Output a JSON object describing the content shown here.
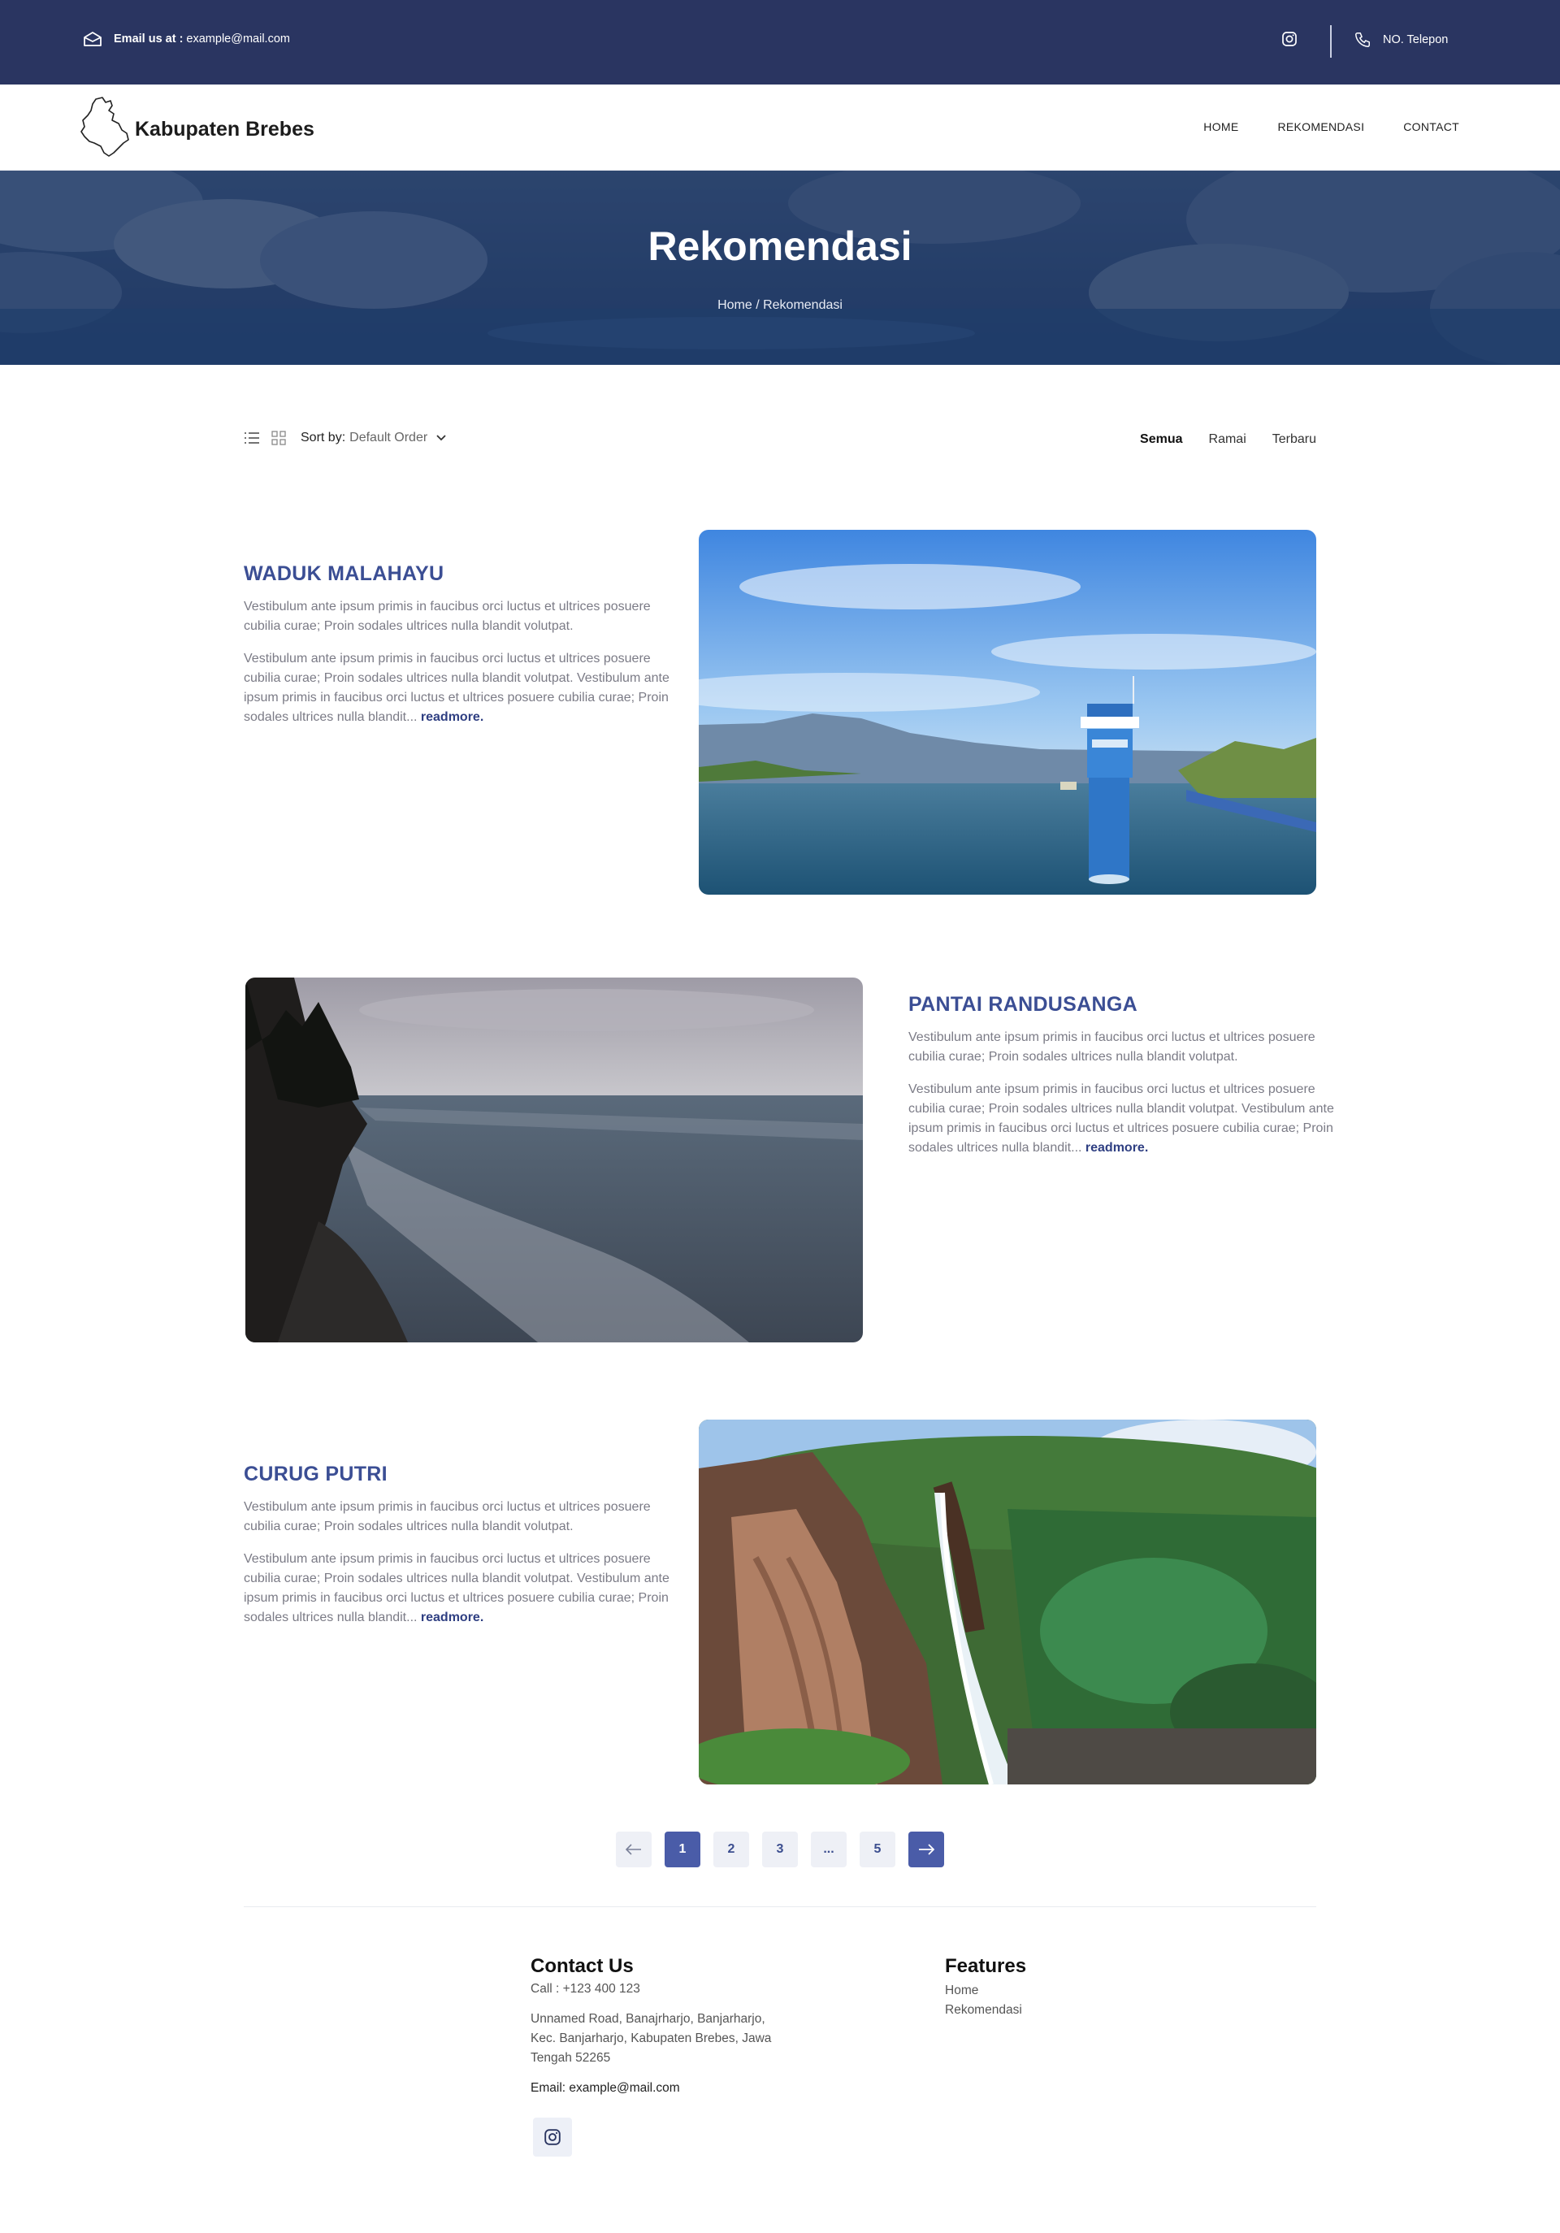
{
  "topbar": {
    "email_label": "Email us at :",
    "email_value": "example@mail.com",
    "phone_label": "NO. Telepon"
  },
  "brand": {
    "name": "Kabupaten Brebes"
  },
  "nav": {
    "items": [
      "HOME",
      "REKOMENDASI",
      "CONTACT"
    ]
  },
  "hero": {
    "title": "Rekomendasi",
    "breadcrumb": "Home / Rekomendasi"
  },
  "toolbar": {
    "sort_label": "Sort by:",
    "sort_value": "Default Order",
    "filters": [
      "Semua",
      "Ramai",
      "Terbaru"
    ],
    "active_filter": "Semua"
  },
  "cards": [
    {
      "title": "WADUK MALAHAYU",
      "p1": "Vestibulum ante ipsum primis in faucibus orci luctus et ultrices posuere cubilia curae; Proin sodales ultrices nulla blandit volutpat.",
      "p2": "Vestibulum ante ipsum primis in faucibus orci luctus et ultrices posuere cubilia curae; Proin sodales ultrices nulla blandit volutpat. Vestibulum ante ipsum primis in faucibus orci luctus et ultrices posuere cubilia curae; Proin sodales ultrices nulla blandit...",
      "more": "readmore."
    },
    {
      "title": "PANTAI RANDUSANGA",
      "p1": "Vestibulum ante ipsum primis in faucibus orci luctus et ultrices posuere cubilia curae; Proin sodales ultrices nulla blandit volutpat.",
      "p2": "Vestibulum ante ipsum primis in faucibus orci luctus et ultrices posuere cubilia curae; Proin sodales ultrices nulla blandit volutpat. Vestibulum ante ipsum primis in faucibus orci luctus et ultrices posuere cubilia curae; Proin sodales ultrices nulla blandit...",
      "more": "readmore."
    },
    {
      "title": "CURUG PUTRI",
      "p1": "Vestibulum ante ipsum primis in faucibus orci luctus et ultrices posuere cubilia curae; Proin sodales ultrices nulla blandit volutpat.",
      "p2": "Vestibulum ante ipsum primis in faucibus orci luctus et ultrices posuere cubilia curae; Proin sodales ultrices nulla blandit volutpat. Vestibulum ante ipsum primis in faucibus orci luctus et ultrices posuere cubilia curae; Proin sodales ultrices nulla blandit...",
      "more": "readmore."
    }
  ],
  "pagination": {
    "pages": [
      "1",
      "2",
      "3",
      "...",
      "5"
    ],
    "current": "1"
  },
  "footer": {
    "contact_title": "Contact Us",
    "call": "Call : +123 400 123",
    "address_1": "Unnamed Road, Banajrharjo, Banjarharjo,",
    "address_2": "Kec. Banjarharjo, Kabupaten Brebes, Jawa",
    "address_3": "Tengah 52265",
    "email": "Email: example@mail.com",
    "features_title": "Features",
    "features": [
      "Home",
      "Rekomendasi"
    ]
  },
  "colors": {
    "topbar": "#2a3561",
    "accent": "#3b4e94",
    "pager_active": "#4a5ca8"
  }
}
